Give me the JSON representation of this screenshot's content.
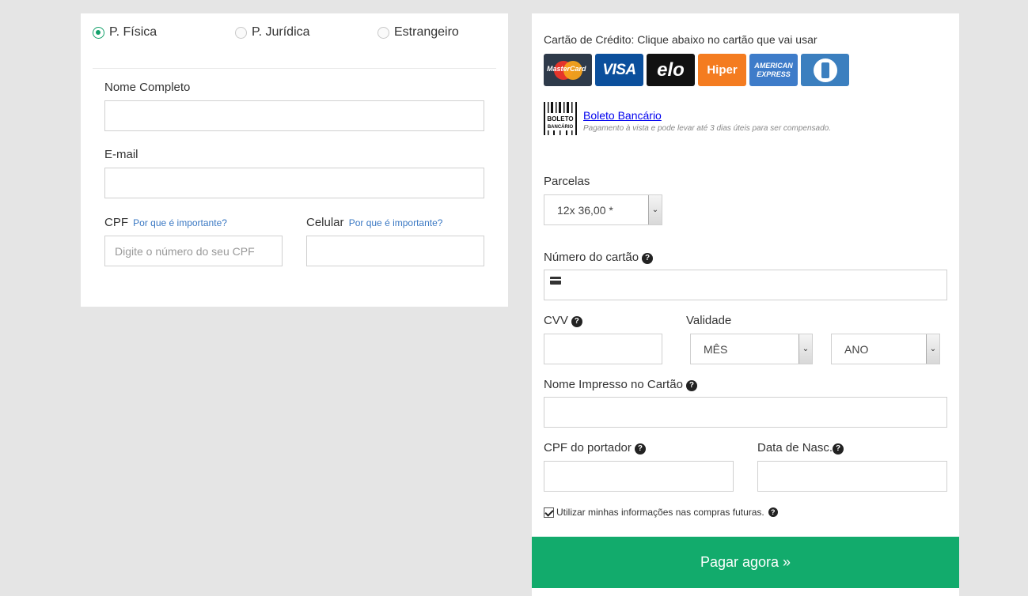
{
  "person_types": [
    {
      "label": "P. Física",
      "checked": true
    },
    {
      "label": "P. Jurídica",
      "checked": false
    },
    {
      "label": "Estrangeiro",
      "checked": false
    }
  ],
  "left_form": {
    "full_name_label": "Nome Completo",
    "full_name_value": "",
    "email_label": "E-mail",
    "email_value": "",
    "cpf_label": "CPF",
    "cpf_help": "Por que é importante?",
    "cpf_placeholder": "Digite o número do seu CPF",
    "phone_label": "Celular",
    "phone_help": "Por que é importante?",
    "phone_value": ""
  },
  "payment": {
    "credit_card_title": "Cartão de Crédito: Clique abaixo no cartão que vai usar",
    "cards": {
      "mastercard": "MasterCard",
      "visa": "VISA",
      "elo": "elo",
      "hiper": "Hiper",
      "amex": "AMERICAN EXPRESS"
    },
    "boleto_icon_text": "BOLETO BANCÁRIO",
    "boleto_link": "Boleto Bancário",
    "boleto_desc": "Pagamento à vista e pode levar até 3 dias úteis para ser compensado.",
    "installments_label": "Parcelas",
    "installments_value": "12x 36,00 *",
    "card_number_label": "Número do cartão",
    "card_number_value": "",
    "cvv_label": "CVV",
    "cvv_value": "",
    "validity_label": "Validade",
    "month_value": "MÊS",
    "year_value": "ANO",
    "printed_name_label": "Nome Impresso no Cartão",
    "printed_name_value": "",
    "holder_cpf_label": "CPF do portador",
    "holder_cpf_value": "",
    "birth_date_label": "Data de Nasc.",
    "birth_date_value": "",
    "save_info_label": "Utilizar minhas informações nas compras futuras.",
    "save_info_checked": true,
    "pay_button": "Pagar agora »"
  },
  "colors": {
    "accent_green": "#12ab6c",
    "link_blue": "#3a78c3",
    "background": "#e5e5e5"
  }
}
